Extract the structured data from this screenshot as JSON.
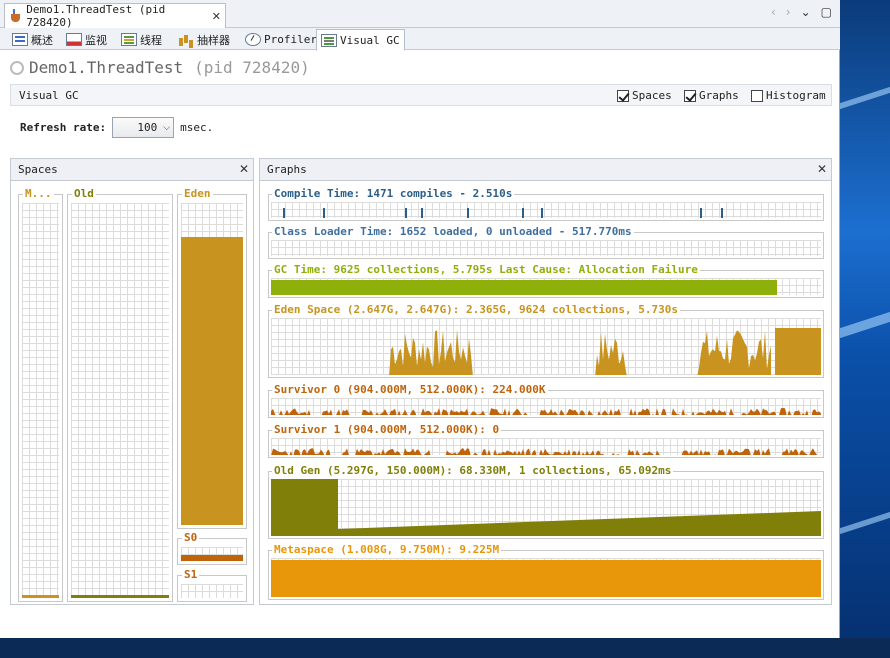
{
  "window": {
    "doc_tab_title": "Demo1.ThreadTest (pid 728420)",
    "nav_icons": [
      "chevron-left-icon",
      "chevron-right-icon",
      "chevron-down-icon",
      "window-restore-icon"
    ]
  },
  "tool_tabs": [
    {
      "label": "概述",
      "icon": "overview-icon"
    },
    {
      "label": "监视",
      "icon": "monitor-icon"
    },
    {
      "label": "线程",
      "icon": "threads-icon"
    },
    {
      "label": "抽样器",
      "icon": "sampler-icon"
    },
    {
      "label": "Profiler",
      "icon": "profiler-icon"
    },
    {
      "label": "Visual GC",
      "icon": "visualgc-icon",
      "active": true
    }
  ],
  "header": {
    "title": "Demo1.ThreadTest",
    "pid": "(pid 728420)"
  },
  "visual_gc_bar": {
    "label": "Visual GC",
    "options": [
      {
        "label": "Spaces",
        "checked": true
      },
      {
        "label": "Graphs",
        "checked": true
      },
      {
        "label": "Histogram",
        "checked": false
      }
    ]
  },
  "refresh": {
    "label": "Refresh rate:",
    "value": "100",
    "unit": "msec."
  },
  "spaces_panel": {
    "title": "Spaces",
    "spaces": [
      {
        "label": "M...",
        "color": "#c8941f",
        "fill_fraction": 0.01
      },
      {
        "label": "Old",
        "color": "#7f7f0a",
        "fill_fraction": 0.013
      },
      {
        "label": "Eden",
        "color": "#c8941f",
        "fill_fraction": 0.893
      },
      {
        "label": "S0",
        "color": "#c0640b",
        "fill_fraction": 0.45
      },
      {
        "label": "S1",
        "color": "#c0640b",
        "fill_fraction": 0.0
      }
    ]
  },
  "graphs_panel": {
    "title": "Graphs",
    "graphs": [
      {
        "label": "Compile Time: 1471 compiles - 2.510s",
        "color": "#2b5f8a"
      },
      {
        "label": "Class Loader Time: 1652 loaded, 0 unloaded - 517.770ms",
        "color": "#3f6fa0"
      },
      {
        "label": "GC Time: 9625 collections, 5.795s  Last Cause: Allocation Failure",
        "color": "#8fb00a"
      },
      {
        "label": "Eden Space (2.647G, 2.647G): 2.365G, 9624 collections, 5.730s",
        "color": "#c8941f"
      },
      {
        "label": "Survivor 0 (904.000M, 512.000K): 224.000K",
        "color": "#c0640b"
      },
      {
        "label": "Survivor 1 (904.000M, 512.000K): 0",
        "color": "#c0640b"
      },
      {
        "label": "Old Gen (5.297G, 150.000M): 68.330M, 1 collections, 65.092ms",
        "color": "#7f7f0a"
      },
      {
        "label": "Metaspace (1.008G, 9.750M): 9.225M",
        "color": "#e8960a"
      }
    ]
  }
}
